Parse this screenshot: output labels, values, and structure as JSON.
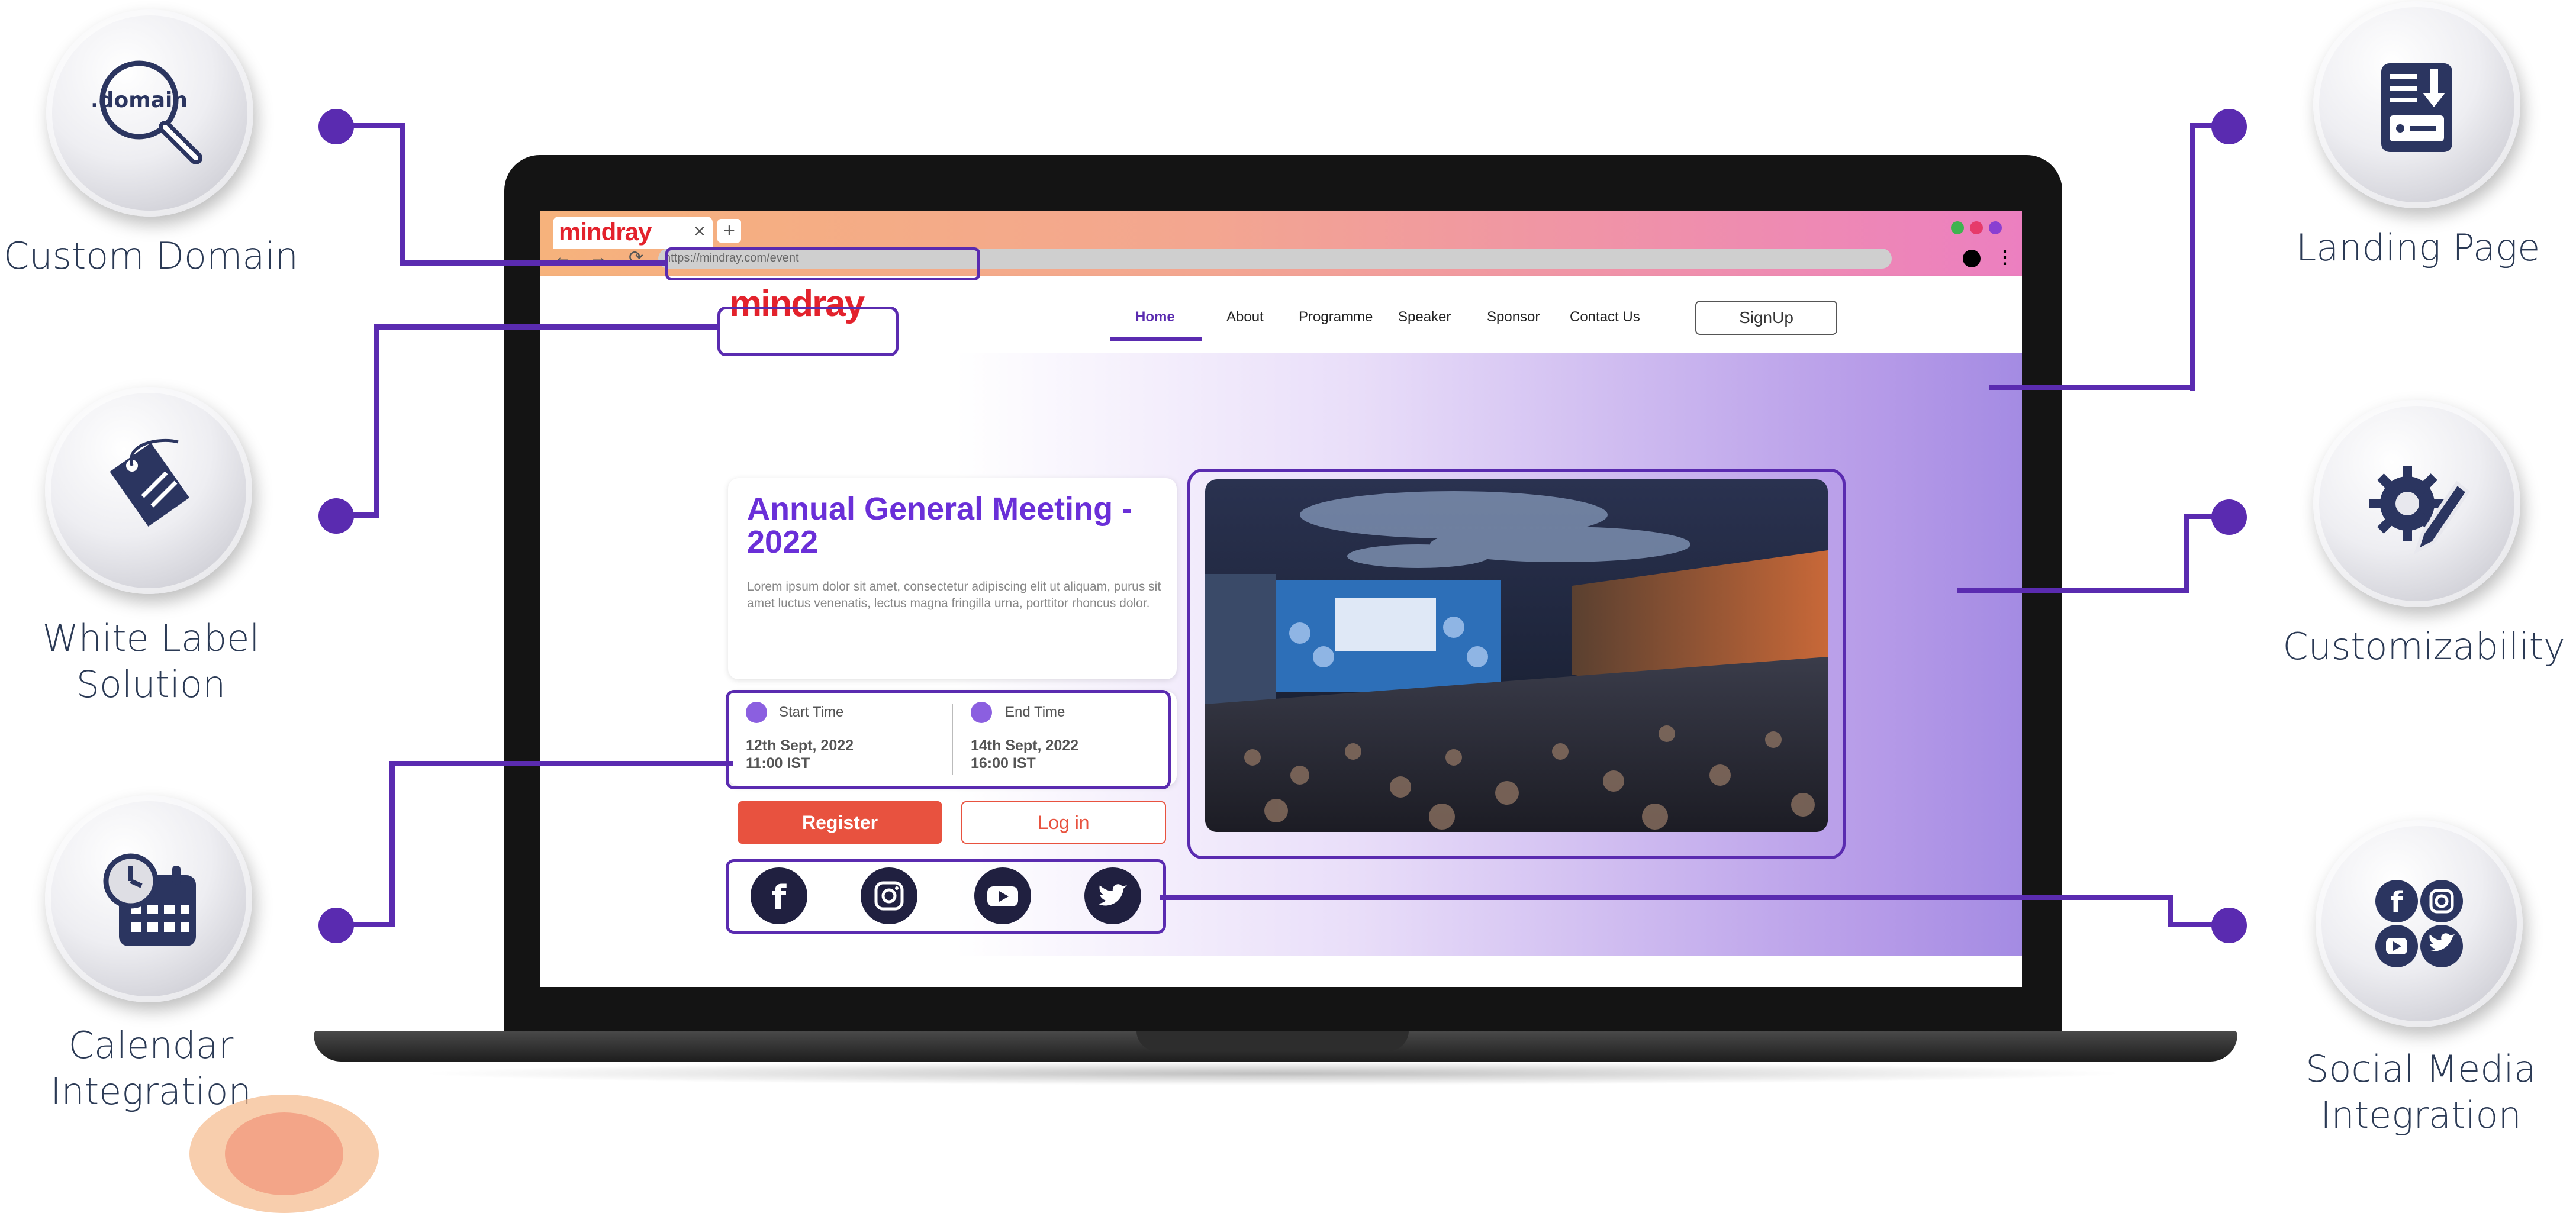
{
  "features": {
    "custom_domain": "Custom Domain",
    "white_label_line1": "White Label",
    "white_label_line2": "Solution",
    "calendar_line1": "Calendar",
    "calendar_line2": "Integration",
    "landing_page": "Landing Page",
    "customizability": "Customizability",
    "social_line1": "Social Media",
    "social_line2": "Integration",
    "domain_icon_text": ".domain"
  },
  "browser": {
    "tab_title": "mindray",
    "tab_close": "×",
    "new_tab": "+",
    "url": "https://mindray.com/event",
    "back": "←",
    "forward": "→",
    "reload": "⟳",
    "menu": "⋮",
    "window_dot_colors": [
      "#3fb34f",
      "#e63b6b",
      "#8a3fd1"
    ]
  },
  "site": {
    "logo": "mindray",
    "nav": [
      "Home",
      "About",
      "Programme",
      "Speaker",
      "Sponsor",
      "Contact Us"
    ],
    "active_nav": "Home",
    "signup": "SignUp",
    "event_title": "Annual General Meeting - 2022",
    "event_description": "Lorem ipsum dolor sit amet, consectetur adipiscing elit ut aliquam, purus sit amet luctus venenatis, lectus magna fringilla urna, porttitor rhoncus dolor.",
    "start_label": "Start Time",
    "start_date": "12th Sept, 2022",
    "start_time": "11:00 IST",
    "end_label": "End Time",
    "end_date": "14th Sept, 2022",
    "end_time": "16:00 IST",
    "register": "Register",
    "login": "Log in",
    "social_icons": [
      "facebook-icon",
      "instagram-icon",
      "youtube-icon",
      "twitter-icon"
    ]
  },
  "colors": {
    "accent": "#5a2bb0",
    "title": "#6a2fd8",
    "brand_red": "#e3222c",
    "register": "#e8523f"
  }
}
